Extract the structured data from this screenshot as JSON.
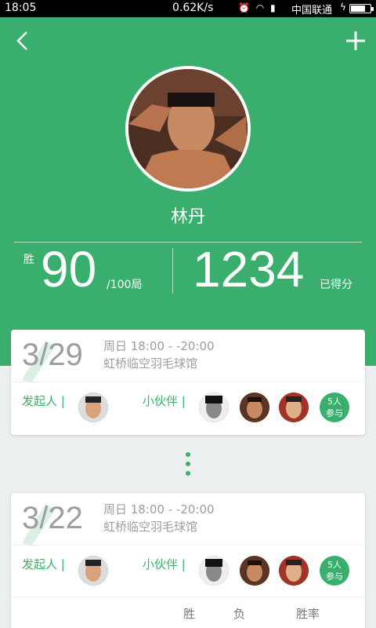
{
  "status_bar": {
    "time": "18:05",
    "speed": "0.62K/s",
    "carrier": "中国联通"
  },
  "profile": {
    "name": "林丹",
    "wins_label": "胜",
    "wins": "90",
    "total": "/100局",
    "score": "1234",
    "score_label": "已得分"
  },
  "events": [
    {
      "date": "3/29",
      "time": "周日 18:00 - -20:00",
      "venue": "虹桥临空羽毛球馆",
      "organizer_label": "发起人",
      "partner_label": "小伙伴",
      "participants_line1": "5人",
      "participants_line2": "参与"
    },
    {
      "date": "3/22",
      "time": "周日 18:00 - -20:00",
      "venue": "虹桥临空羽毛球馆",
      "organizer_label": "发起人",
      "partner_label": "小伙伴",
      "participants_line1": "5人",
      "participants_line2": "参与",
      "stats_headers": [
        "胜",
        "负",
        "胜率"
      ]
    }
  ],
  "colors": {
    "accent": "#3aaf6d",
    "muted_text": "#9e9e9e",
    "background": "#eceff0"
  },
  "icons": {
    "back": "chevron-left-icon",
    "add": "plus-icon"
  }
}
